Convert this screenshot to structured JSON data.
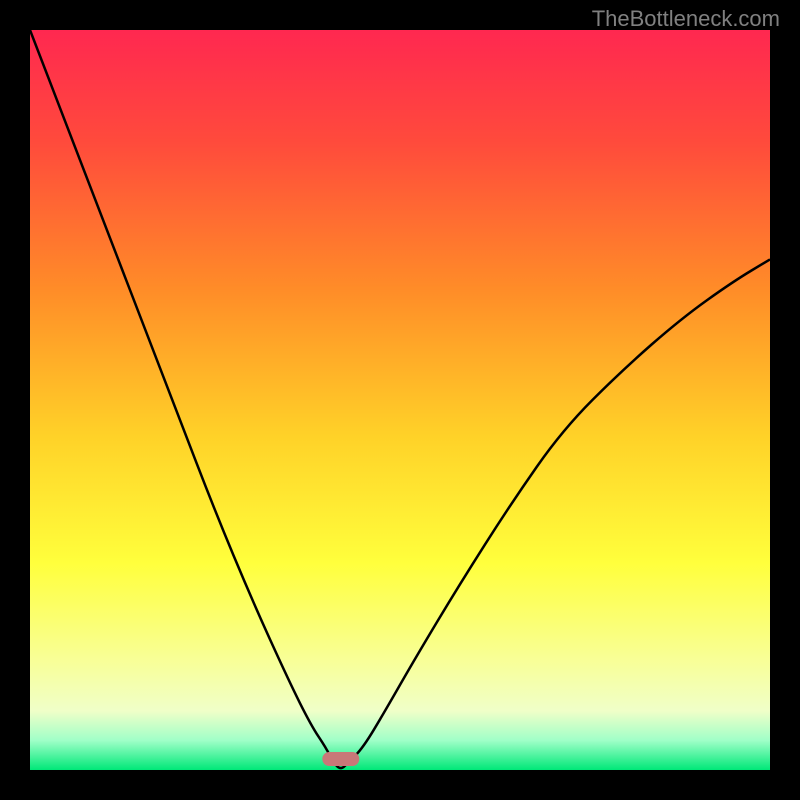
{
  "watermark": "TheBottleneck.com",
  "chart_data": {
    "type": "line",
    "title": "",
    "xlabel": "",
    "ylabel": "",
    "xlim": [
      0,
      100
    ],
    "ylim": [
      0,
      100
    ],
    "x": [
      0,
      5,
      10,
      15,
      20,
      25,
      30,
      35,
      38,
      40,
      41,
      42,
      43,
      45,
      48,
      52,
      58,
      65,
      72,
      80,
      88,
      95,
      100
    ],
    "values": [
      100,
      87,
      74,
      61,
      48,
      35,
      23,
      12,
      6,
      3,
      1,
      0,
      1,
      3,
      8,
      15,
      25,
      36,
      46,
      54,
      61,
      66,
      69
    ],
    "minimum_x": 42,
    "minimum_marker": {
      "x": 42,
      "y": 0,
      "width": 5,
      "height": 2,
      "color": "#c87878"
    },
    "background_gradient": {
      "type": "vertical",
      "stops": [
        {
          "offset": 0.0,
          "color": "#ff2850"
        },
        {
          "offset": 0.15,
          "color": "#ff4a3c"
        },
        {
          "offset": 0.35,
          "color": "#ff8c28"
        },
        {
          "offset": 0.55,
          "color": "#ffd228"
        },
        {
          "offset": 0.72,
          "color": "#ffff3c"
        },
        {
          "offset": 0.85,
          "color": "#f8ff96"
        },
        {
          "offset": 0.92,
          "color": "#f0ffc8"
        },
        {
          "offset": 0.96,
          "color": "#a0ffc8"
        },
        {
          "offset": 1.0,
          "color": "#00e878"
        }
      ]
    }
  }
}
